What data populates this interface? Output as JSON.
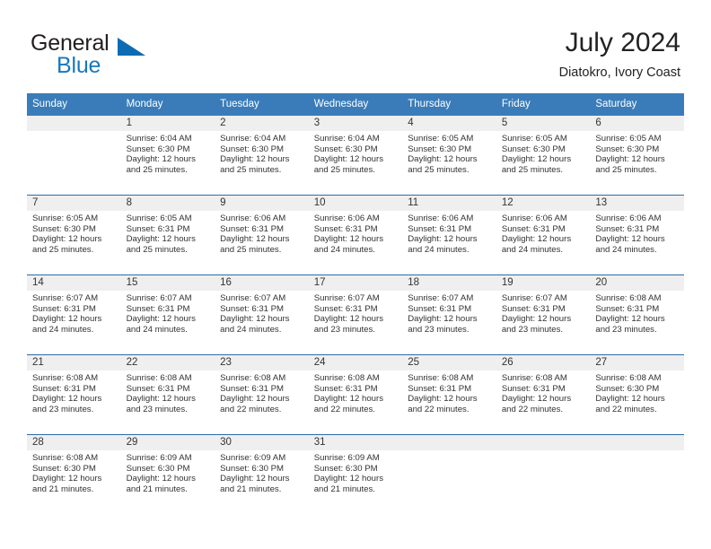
{
  "brand": {
    "name_top": "General",
    "name_bottom": "Blue",
    "triangle_color": "#0b6cb3",
    "blue_text_color": "#1878be"
  },
  "header": {
    "title": "July 2024",
    "subtitle": "Diatokro, Ivory Coast",
    "header_bg_color": "#3a7cb9",
    "row_divider_color": "#2e6ba8",
    "daynum_bg_color": "#efeff0"
  },
  "weekdays": [
    "Sunday",
    "Monday",
    "Tuesday",
    "Wednesday",
    "Thursday",
    "Friday",
    "Saturday"
  ],
  "labels": {
    "sunrise_prefix": "Sunrise:",
    "sunset_prefix": "Sunset:",
    "daylight_prefix": "Daylight:"
  },
  "weeks": [
    [
      {
        "day": "",
        "sunrise": "",
        "sunset": "",
        "daylight_line1": "",
        "daylight_line2": ""
      },
      {
        "day": "1",
        "sunrise": "Sunrise: 6:04 AM",
        "sunset": "Sunset: 6:30 PM",
        "daylight_line1": "Daylight: 12 hours",
        "daylight_line2": "and 25 minutes."
      },
      {
        "day": "2",
        "sunrise": "Sunrise: 6:04 AM",
        "sunset": "Sunset: 6:30 PM",
        "daylight_line1": "Daylight: 12 hours",
        "daylight_line2": "and 25 minutes."
      },
      {
        "day": "3",
        "sunrise": "Sunrise: 6:04 AM",
        "sunset": "Sunset: 6:30 PM",
        "daylight_line1": "Daylight: 12 hours",
        "daylight_line2": "and 25 minutes."
      },
      {
        "day": "4",
        "sunrise": "Sunrise: 6:05 AM",
        "sunset": "Sunset: 6:30 PM",
        "daylight_line1": "Daylight: 12 hours",
        "daylight_line2": "and 25 minutes."
      },
      {
        "day": "5",
        "sunrise": "Sunrise: 6:05 AM",
        "sunset": "Sunset: 6:30 PM",
        "daylight_line1": "Daylight: 12 hours",
        "daylight_line2": "and 25 minutes."
      },
      {
        "day": "6",
        "sunrise": "Sunrise: 6:05 AM",
        "sunset": "Sunset: 6:30 PM",
        "daylight_line1": "Daylight: 12 hours",
        "daylight_line2": "and 25 minutes."
      }
    ],
    [
      {
        "day": "7",
        "sunrise": "Sunrise: 6:05 AM",
        "sunset": "Sunset: 6:30 PM",
        "daylight_line1": "Daylight: 12 hours",
        "daylight_line2": "and 25 minutes."
      },
      {
        "day": "8",
        "sunrise": "Sunrise: 6:05 AM",
        "sunset": "Sunset: 6:31 PM",
        "daylight_line1": "Daylight: 12 hours",
        "daylight_line2": "and 25 minutes."
      },
      {
        "day": "9",
        "sunrise": "Sunrise: 6:06 AM",
        "sunset": "Sunset: 6:31 PM",
        "daylight_line1": "Daylight: 12 hours",
        "daylight_line2": "and 25 minutes."
      },
      {
        "day": "10",
        "sunrise": "Sunrise: 6:06 AM",
        "sunset": "Sunset: 6:31 PM",
        "daylight_line1": "Daylight: 12 hours",
        "daylight_line2": "and 24 minutes."
      },
      {
        "day": "11",
        "sunrise": "Sunrise: 6:06 AM",
        "sunset": "Sunset: 6:31 PM",
        "daylight_line1": "Daylight: 12 hours",
        "daylight_line2": "and 24 minutes."
      },
      {
        "day": "12",
        "sunrise": "Sunrise: 6:06 AM",
        "sunset": "Sunset: 6:31 PM",
        "daylight_line1": "Daylight: 12 hours",
        "daylight_line2": "and 24 minutes."
      },
      {
        "day": "13",
        "sunrise": "Sunrise: 6:06 AM",
        "sunset": "Sunset: 6:31 PM",
        "daylight_line1": "Daylight: 12 hours",
        "daylight_line2": "and 24 minutes."
      }
    ],
    [
      {
        "day": "14",
        "sunrise": "Sunrise: 6:07 AM",
        "sunset": "Sunset: 6:31 PM",
        "daylight_line1": "Daylight: 12 hours",
        "daylight_line2": "and 24 minutes."
      },
      {
        "day": "15",
        "sunrise": "Sunrise: 6:07 AM",
        "sunset": "Sunset: 6:31 PM",
        "daylight_line1": "Daylight: 12 hours",
        "daylight_line2": "and 24 minutes."
      },
      {
        "day": "16",
        "sunrise": "Sunrise: 6:07 AM",
        "sunset": "Sunset: 6:31 PM",
        "daylight_line1": "Daylight: 12 hours",
        "daylight_line2": "and 24 minutes."
      },
      {
        "day": "17",
        "sunrise": "Sunrise: 6:07 AM",
        "sunset": "Sunset: 6:31 PM",
        "daylight_line1": "Daylight: 12 hours",
        "daylight_line2": "and 23 minutes."
      },
      {
        "day": "18",
        "sunrise": "Sunrise: 6:07 AM",
        "sunset": "Sunset: 6:31 PM",
        "daylight_line1": "Daylight: 12 hours",
        "daylight_line2": "and 23 minutes."
      },
      {
        "day": "19",
        "sunrise": "Sunrise: 6:07 AM",
        "sunset": "Sunset: 6:31 PM",
        "daylight_line1": "Daylight: 12 hours",
        "daylight_line2": "and 23 minutes."
      },
      {
        "day": "20",
        "sunrise": "Sunrise: 6:08 AM",
        "sunset": "Sunset: 6:31 PM",
        "daylight_line1": "Daylight: 12 hours",
        "daylight_line2": "and 23 minutes."
      }
    ],
    [
      {
        "day": "21",
        "sunrise": "Sunrise: 6:08 AM",
        "sunset": "Sunset: 6:31 PM",
        "daylight_line1": "Daylight: 12 hours",
        "daylight_line2": "and 23 minutes."
      },
      {
        "day": "22",
        "sunrise": "Sunrise: 6:08 AM",
        "sunset": "Sunset: 6:31 PM",
        "daylight_line1": "Daylight: 12 hours",
        "daylight_line2": "and 23 minutes."
      },
      {
        "day": "23",
        "sunrise": "Sunrise: 6:08 AM",
        "sunset": "Sunset: 6:31 PM",
        "daylight_line1": "Daylight: 12 hours",
        "daylight_line2": "and 22 minutes."
      },
      {
        "day": "24",
        "sunrise": "Sunrise: 6:08 AM",
        "sunset": "Sunset: 6:31 PM",
        "daylight_line1": "Daylight: 12 hours",
        "daylight_line2": "and 22 minutes."
      },
      {
        "day": "25",
        "sunrise": "Sunrise: 6:08 AM",
        "sunset": "Sunset: 6:31 PM",
        "daylight_line1": "Daylight: 12 hours",
        "daylight_line2": "and 22 minutes."
      },
      {
        "day": "26",
        "sunrise": "Sunrise: 6:08 AM",
        "sunset": "Sunset: 6:31 PM",
        "daylight_line1": "Daylight: 12 hours",
        "daylight_line2": "and 22 minutes."
      },
      {
        "day": "27",
        "sunrise": "Sunrise: 6:08 AM",
        "sunset": "Sunset: 6:30 PM",
        "daylight_line1": "Daylight: 12 hours",
        "daylight_line2": "and 22 minutes."
      }
    ],
    [
      {
        "day": "28",
        "sunrise": "Sunrise: 6:08 AM",
        "sunset": "Sunset: 6:30 PM",
        "daylight_line1": "Daylight: 12 hours",
        "daylight_line2": "and 21 minutes."
      },
      {
        "day": "29",
        "sunrise": "Sunrise: 6:09 AM",
        "sunset": "Sunset: 6:30 PM",
        "daylight_line1": "Daylight: 12 hours",
        "daylight_line2": "and 21 minutes."
      },
      {
        "day": "30",
        "sunrise": "Sunrise: 6:09 AM",
        "sunset": "Sunset: 6:30 PM",
        "daylight_line1": "Daylight: 12 hours",
        "daylight_line2": "and 21 minutes."
      },
      {
        "day": "31",
        "sunrise": "Sunrise: 6:09 AM",
        "sunset": "Sunset: 6:30 PM",
        "daylight_line1": "Daylight: 12 hours",
        "daylight_line2": "and 21 minutes."
      },
      {
        "day": "",
        "sunrise": "",
        "sunset": "",
        "daylight_line1": "",
        "daylight_line2": ""
      },
      {
        "day": "",
        "sunrise": "",
        "sunset": "",
        "daylight_line1": "",
        "daylight_line2": ""
      },
      {
        "day": "",
        "sunrise": "",
        "sunset": "",
        "daylight_line1": "",
        "daylight_line2": ""
      }
    ]
  ]
}
